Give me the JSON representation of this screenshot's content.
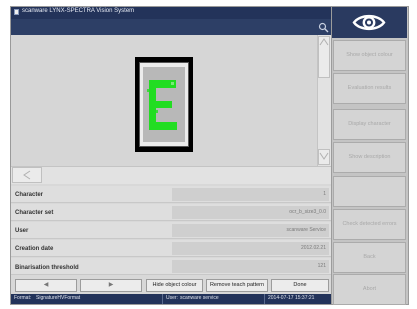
{
  "window": {
    "title": "scanware LYNX-SPECTRA Vision System"
  },
  "viewer": {
    "character_shown": "E",
    "glyph_color": "#22dd22"
  },
  "properties": [
    {
      "label": "Character",
      "value": "1"
    },
    {
      "label": "Character set",
      "value": "ocr_b_size3_0.0"
    },
    {
      "label": "User",
      "value": "scanware Service"
    },
    {
      "label": "Creation date",
      "value": "2012.02.21"
    },
    {
      "label": "Binarisation threshold",
      "value": "121"
    }
  ],
  "bottom_buttons": {
    "prev_label": "◀",
    "next_label": "▶",
    "hide_colour_label": "Hide object colour",
    "remove_pattern_label": "Remove teach pattern",
    "done_label": "Done"
  },
  "status": {
    "format_label": "Format:",
    "format_value": "SignatureHVFormat",
    "user_label": "User:",
    "user_value": "scanware service",
    "datetime": "2014-07-17 15:37:21"
  },
  "side_panel": {
    "buttons": [
      "Show object colour",
      "Evaluation results",
      "Display character",
      "Show description",
      "",
      "Check detected errors",
      "Back",
      "Abort"
    ]
  },
  "colors": {
    "title_bar": "#23335a",
    "accent_green": "#22dd22"
  }
}
